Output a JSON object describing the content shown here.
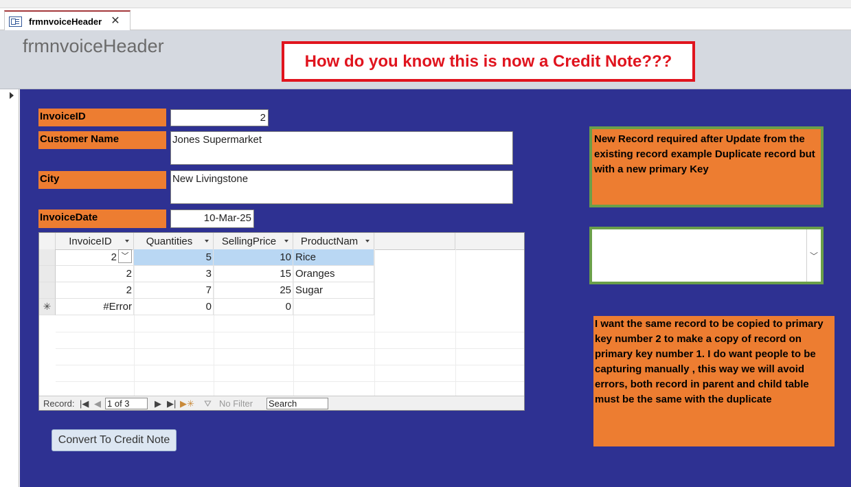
{
  "window": {
    "tab_title": "frmnvoiceHeader",
    "close_glyph": "✕"
  },
  "form": {
    "title": "frmnvoiceHeader",
    "callout": "How do you know this is now a Credit Note???",
    "labels": {
      "invoice_id": "InvoiceID",
      "customer_name": "Customer Name",
      "city": "City",
      "invoice_date": "InvoiceDate"
    },
    "values": {
      "invoice_id": "2",
      "customer_name": "Jones Supermarket",
      "city": "New Livingstone",
      "invoice_date": "10-Mar-25"
    },
    "note1": "New Record required after Update from the existing record  example Duplicate record but with a new primary Key",
    "note2": "I want the same record to be copied to primary key number 2 to make a copy of record on primary key number 1. I do want people to be capturing manually , this way we will avoid errors, both record in parent and child table must be the same with the duplicate",
    "button_label": "Convert To Credit Note"
  },
  "subform": {
    "columns": [
      "InvoiceID",
      "Quantities",
      "SellingPrice",
      "ProductNam"
    ],
    "rows": [
      {
        "invoice_id": "2",
        "quantities": "5",
        "selling_price": "10",
        "product": "Rice"
      },
      {
        "invoice_id": "2",
        "quantities": "3",
        "selling_price": "15",
        "product": "Oranges"
      },
      {
        "invoice_id": "2",
        "quantities": "7",
        "selling_price": "25",
        "product": "Sugar"
      }
    ],
    "new_row": {
      "marker": "✳",
      "invoice_id": "#Error",
      "quantities": "0",
      "selling_price": "0"
    },
    "nav": {
      "record_label": "Record:",
      "position": "1 of 3",
      "filter_label": "No Filter",
      "search_label": "Search"
    }
  },
  "icons": {
    "tab": "form-icon",
    "record_selector": "triangle-right-icon",
    "dropdown": "chevron-down-icon"
  },
  "colors": {
    "detail_bg": "#2e3192",
    "label_bg": "#ed7d31",
    "callout": "#e0141e",
    "green_border": "#6a9f4a",
    "tab_accent": "#a4373a",
    "selected_cell": "#b9d7f3"
  }
}
